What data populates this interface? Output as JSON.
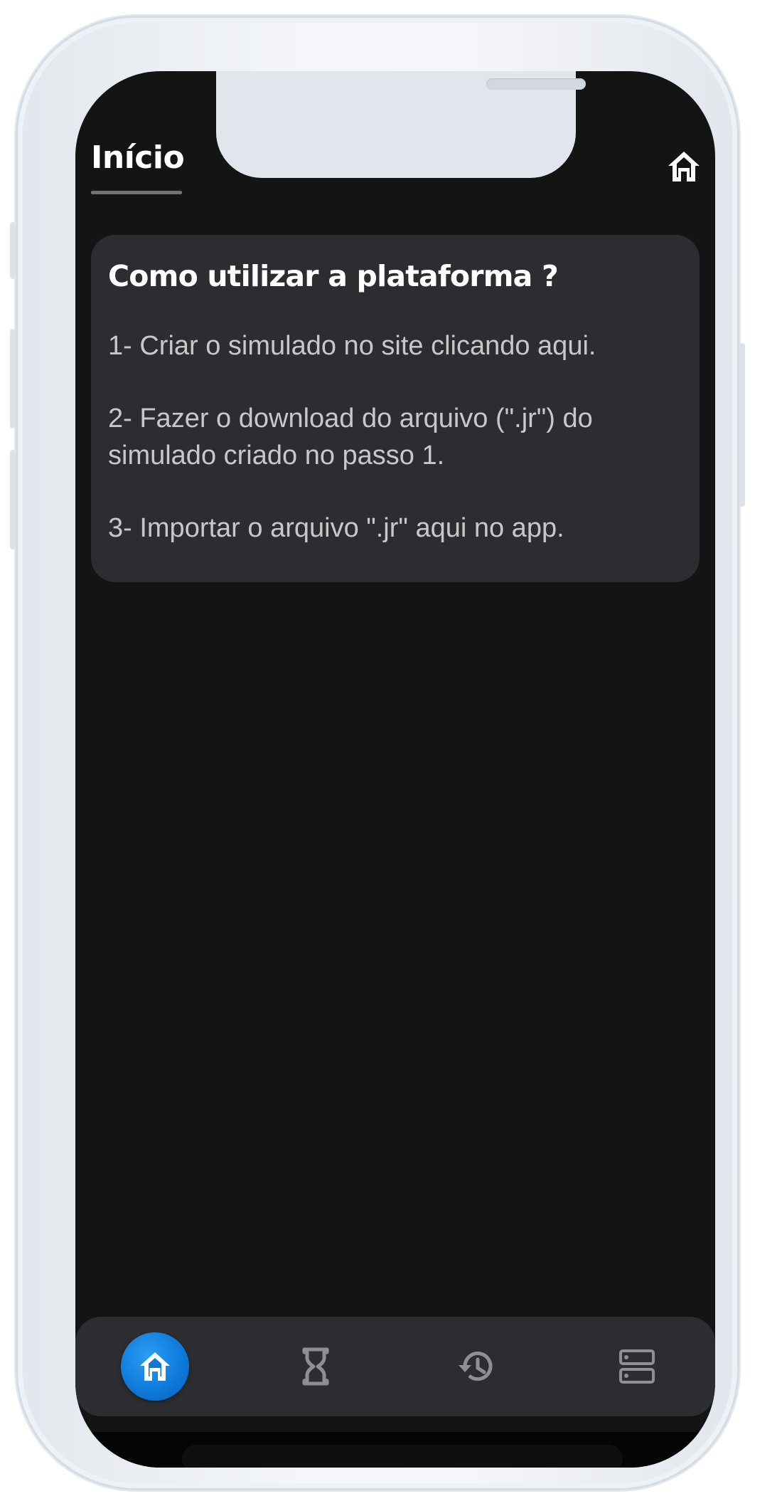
{
  "header": {
    "title": "Início",
    "home_icon": "home-icon"
  },
  "card": {
    "title": "Como utilizar a plataforma ?",
    "steps": [
      "1- Criar o simulado no site clicando aqui.",
      "2- Fazer o download do arquivo (\".jr\") do simulado criado no passo 1.",
      "3- Importar o arquivo \".jr\" aqui no app."
    ]
  },
  "bottom_nav": {
    "items": [
      {
        "icon": "home-icon",
        "active": true
      },
      {
        "icon": "hourglass-icon",
        "active": false
      },
      {
        "icon": "history-icon",
        "active": false
      },
      {
        "icon": "storage-list-icon",
        "active": false
      }
    ],
    "active_color": "#0d78d8",
    "inactive_color": "#8e8f93"
  },
  "colors": {
    "background": "#141414",
    "card": "#2c2d31",
    "text_primary": "#ffffff",
    "text_secondary": "#c7c8ca"
  }
}
